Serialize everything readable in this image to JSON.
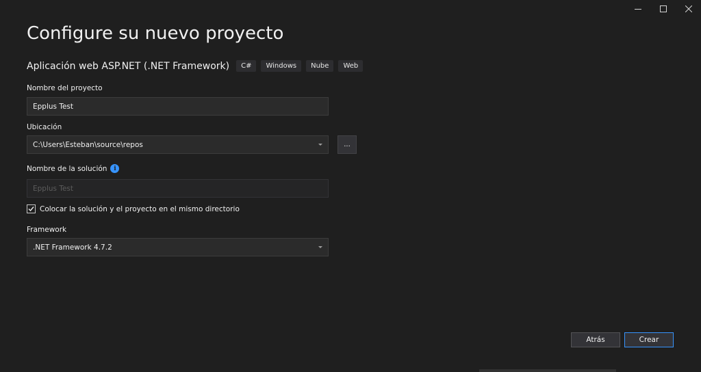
{
  "window": {
    "title": "Configure su nuevo proyecto",
    "caption": {
      "minimize": "minimize-icon",
      "maximize": "maximize-icon",
      "close": "close-icon"
    }
  },
  "template": {
    "name": "Aplicación web ASP.NET (.NET Framework)",
    "tags": [
      "C#",
      "Windows",
      "Nube",
      "Web"
    ]
  },
  "project_name": {
    "label": "Nombre del proyecto",
    "value": "Epplus Test"
  },
  "location": {
    "label": "Ubicación",
    "value": "C:\\Users\\Esteban\\source\\repos",
    "browse_label": "..."
  },
  "solution_name": {
    "label": "Nombre de la solución",
    "info_icon": "info-icon",
    "placeholder": "Epplus Test"
  },
  "same_directory": {
    "label": "Colocar la solución y el proyecto en el mismo directorio",
    "checked": true
  },
  "framework": {
    "label": "Framework",
    "value": ".NET Framework 4.7.2"
  },
  "buttons": {
    "back": "Atrás",
    "create": "Crear"
  },
  "colors": {
    "background": "#1f1f1f",
    "input": "#2b2b2b",
    "accent": "#3794ff",
    "text": "#f1f1f1"
  }
}
